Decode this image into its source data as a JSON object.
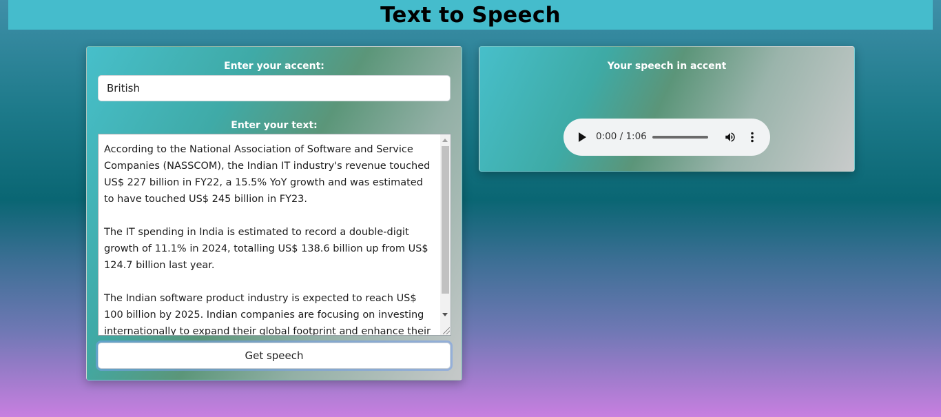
{
  "header": {
    "title": "Text to Speech"
  },
  "form": {
    "accent_label": "Enter your accent:",
    "accent_value": "British",
    "text_label": "Enter your text:",
    "text_paragraphs": [
      "According to the National Association of Software and Service Companies (NASSCOM), the Indian IT industry's revenue touched US$ 227 billion in FY22, a 15.5% YoY growth and was estimated to have touched US$ 245 billion in FY23.",
      "The IT spending in India is estimated to record a double-digit growth of 11.1% in 2024, totalling US$ 138.6 billion up from US$ 124.7 billion last year.",
      "The Indian software product industry is expected to reach US$ 100 billion by 2025. Indian companies are focusing on investing internationally to expand their global footprint and enhance their"
    ],
    "submit_label": "Get speech"
  },
  "output": {
    "title": "Your speech in accent",
    "audio": {
      "time_display": "0:00 / 1:06",
      "progress_fraction": 0,
      "icons": [
        "play-icon",
        "volume-icon",
        "more-vertical-icon"
      ]
    }
  },
  "colors": {
    "header_bg": "#45bccc",
    "card_gradient_start": "#47bfca",
    "card_gradient_mid": "#5b9679",
    "card_gradient_end": "#c6c9c9",
    "page_gradient_top": "#3f8fa8",
    "page_gradient_bottom": "#c87fe0"
  }
}
